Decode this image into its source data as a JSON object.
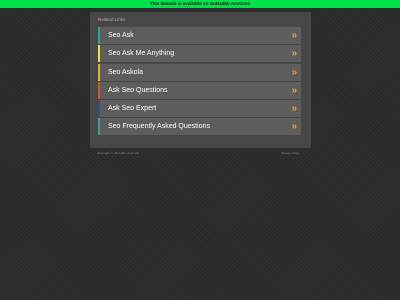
{
  "banner": {
    "text": "This domain is available on GoDaddy Auctions",
    "color": "#00e24a"
  },
  "panel": {
    "heading": "Related Links",
    "links": [
      {
        "label": "Seo Ask",
        "accent": "#2ea69b"
      },
      {
        "label": "Seo Ask Me Anything",
        "accent": "#e6e04a"
      },
      {
        "label": "Seo Askola",
        "accent": "#e0b72c"
      },
      {
        "label": "Ask Seo Questions",
        "accent": "#d9542f"
      },
      {
        "label": "Ask Seo Expert",
        "accent": "#2a5c7a"
      },
      {
        "label": "Seo Frequently Asked Questions",
        "accent": "#3aa192"
      }
    ],
    "arrow_glyph": "»",
    "arrow_color": "#f29a2e",
    "arrow_icon": "double-chevron-right-icon"
  },
  "footer": {
    "copyright": "Copyright ©. All rights reserved.",
    "privacy": "Privacy Policy"
  }
}
